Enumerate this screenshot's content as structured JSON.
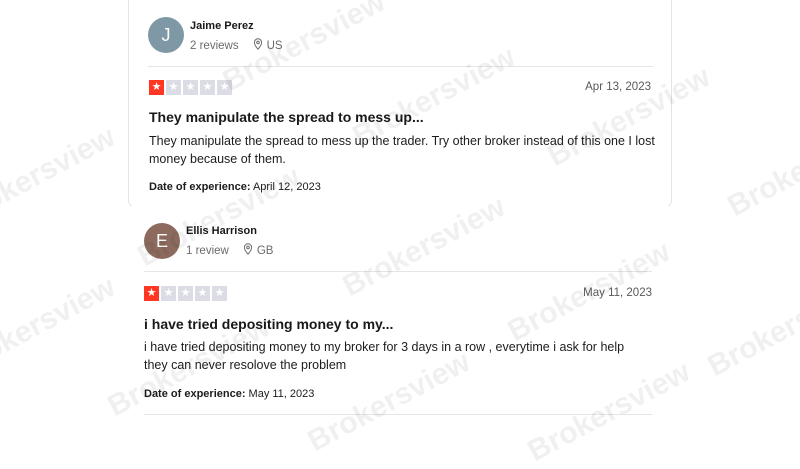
{
  "watermark": "Brokersview",
  "reviews": [
    {
      "avatar_letter": "J",
      "avatar_color": "#7f98a6",
      "name": "Jaime Perez",
      "review_count": "2 reviews",
      "country": "US",
      "rating": 1,
      "date": "Apr 13, 2023",
      "title": "They manipulate the spread to mess up...",
      "body": "They manipulate the spread to mess up the trader. Try other broker instead of this one I lost money because of them.",
      "experience_label": "Date of experience:",
      "experience_date": "April 12, 2023"
    },
    {
      "avatar_letter": "E",
      "avatar_color": "#8c6b5e",
      "name": "Ellis Harrison",
      "review_count": "1 review",
      "country": "GB",
      "rating": 1,
      "date": "May 11, 2023",
      "title": "i have tried depositing money to my...",
      "body": "i have tried depositing money to my broker for 3 days in a row , everytime i ask for help they can never resolove the problem",
      "experience_label": "Date of experience:",
      "experience_date": "May 11, 2023"
    }
  ],
  "colors": {
    "star_on": "#ff3722",
    "star_off": "#dcdce6"
  }
}
